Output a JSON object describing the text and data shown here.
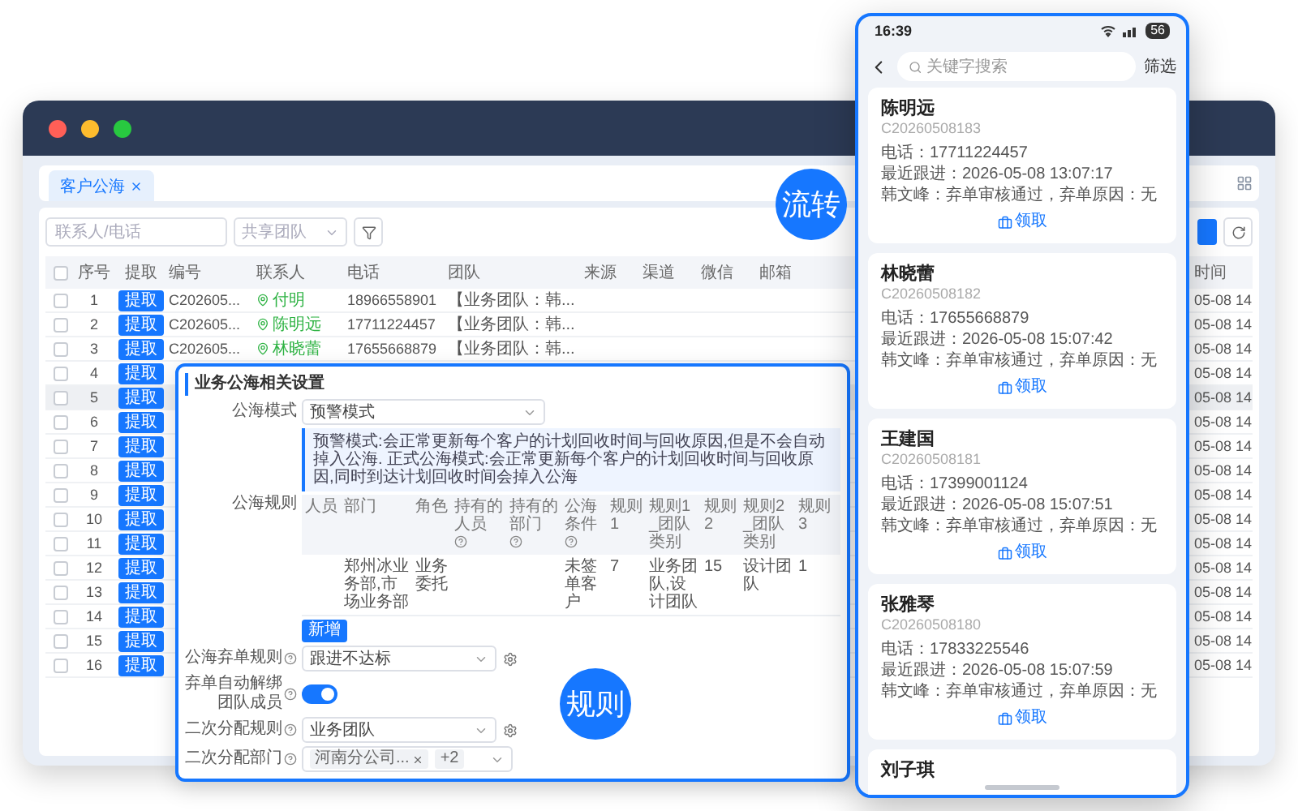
{
  "browser": {
    "tab": {
      "label": "客户公海",
      "closable": true
    },
    "toolbar": {
      "search_placeholder": "联系人/电话",
      "team_placeholder": "共享团队"
    },
    "table": {
      "header_checked": false,
      "columns": [
        "序号",
        "提取",
        "编号",
        "联系人",
        "电话",
        "团队",
        "来源",
        "渠道",
        "微信",
        "邮箱"
      ],
      "time_column": "时间",
      "rows": [
        {
          "index": "1",
          "action": "提取",
          "code": "C202605...",
          "contact": "付明",
          "phone": "18966558901",
          "team": "【业务团队：韩...",
          "time": "05-08 14",
          "checked": false,
          "hovered": false
        },
        {
          "index": "2",
          "action": "提取",
          "code": "C202605...",
          "contact": "陈明远",
          "phone": "17711224457",
          "team": "【业务团队：韩...",
          "time": "05-08 14",
          "checked": false,
          "hovered": false
        },
        {
          "index": "3",
          "action": "提取",
          "code": "C202605...",
          "contact": "林晓蕾",
          "phone": "17655668879",
          "team": "【业务团队：韩...",
          "time": "05-08 14",
          "checked": false,
          "hovered": false
        },
        {
          "index": "4",
          "action": "提取",
          "time": "05-08 14",
          "checked": false,
          "hovered": false
        },
        {
          "index": "5",
          "action": "提取",
          "time": "05-08 14",
          "checked": false,
          "hovered": true
        },
        {
          "index": "6",
          "action": "提取",
          "time": "05-08 14",
          "checked": false,
          "hovered": false
        },
        {
          "index": "7",
          "action": "提取",
          "time": "05-08 14",
          "checked": false,
          "hovered": false
        },
        {
          "index": "8",
          "action": "提取",
          "time": "05-08 14",
          "checked": false,
          "hovered": false
        },
        {
          "index": "9",
          "action": "提取",
          "time": "05-08 14",
          "checked": false,
          "hovered": false
        },
        {
          "index": "10",
          "action": "提取",
          "time": "05-08 14",
          "checked": false,
          "hovered": false
        },
        {
          "index": "11",
          "action": "提取",
          "time": "05-08 14",
          "checked": false,
          "hovered": false
        },
        {
          "index": "12",
          "action": "提取",
          "time": "05-08 14",
          "checked": false,
          "hovered": false
        },
        {
          "index": "13",
          "action": "提取",
          "time": "05-08 14",
          "checked": false,
          "hovered": false
        },
        {
          "index": "14",
          "action": "提取",
          "time": "05-08 14",
          "checked": false,
          "hovered": false
        },
        {
          "index": "15",
          "action": "提取",
          "time": "05-08 14",
          "checked": false,
          "hovered": false
        },
        {
          "index": "16",
          "action": "提取",
          "time": "05-08 14",
          "checked": false,
          "hovered": false
        }
      ]
    }
  },
  "dialog": {
    "title": "业务公海相关设置",
    "mode": {
      "label": "公海模式",
      "value": "预警模式"
    },
    "note": "预警模式:会正常更新每个客户的计划回收时间与回收原因,但是不会自动掉入公海. 正式公海模式:会正常更新每个客户的计划回收时间与回收原因,同时到达计划回收时间会掉入公海",
    "rules": {
      "label": "公海规则",
      "columns": [
        {
          "label": "人员",
          "help": false
        },
        {
          "label": "部门",
          "help": false
        },
        {
          "label": "角色",
          "help": false
        },
        {
          "label": "持有的人员",
          "help": true
        },
        {
          "label": "持有的部门",
          "help": true
        },
        {
          "label": "公海条件",
          "help": true
        },
        {
          "label": "规则1",
          "help": false
        },
        {
          "label": "规则1_团队类别",
          "help": false
        },
        {
          "label": "规则2",
          "help": false
        },
        {
          "label": "规则2_团队类别",
          "help": false
        },
        {
          "label": "规则3",
          "help": false
        }
      ],
      "rows": [
        [
          null,
          "郑州冰业务部,市场业务部",
          "业务委托",
          null,
          null,
          "未签单客户",
          "7",
          "业务团队,设计团队",
          "15",
          "设计团队",
          "1"
        ]
      ],
      "add_label": "新增"
    },
    "settings": [
      {
        "kind": "select",
        "label": "公海弃单规则",
        "help": true,
        "value": "跟进不达标",
        "gear": true
      },
      {
        "kind": "toggle",
        "label": "弃单自动解绑团队成员",
        "help": true,
        "on": true
      },
      {
        "kind": "select",
        "label": "二次分配规则",
        "help": true,
        "value": "业务团队",
        "gear": true
      },
      {
        "kind": "tags",
        "label": "二次分配部门",
        "help": true,
        "tags": [
          "河南分公司..."
        ],
        "more": "+2"
      }
    ]
  },
  "phone": {
    "status": {
      "time": "16:39",
      "battery": "56"
    },
    "search": {
      "placeholder": "关键字搜索"
    },
    "filter": "筛选",
    "cards": [
      {
        "name": "陈明远",
        "code": "C20260508183",
        "lines": [
          "电话：17711224457",
          "最近跟进：2026-05-08 13:07:17",
          "韩文峰：弃单审核通过，弃单原因：无"
        ],
        "action": "领取"
      },
      {
        "name": "林晓蕾",
        "code": "C20260508182",
        "lines": [
          "电话：17655668879",
          "最近跟进：2026-05-08 15:07:42",
          "韩文峰：弃单审核通过，弃单原因：无"
        ],
        "action": "领取"
      },
      {
        "name": "王建国",
        "code": "C20260508181",
        "lines": [
          "电话：17399001124",
          "最近跟进：2026-05-08 15:07:51",
          "韩文峰：弃单审核通过，弃单原因：无"
        ],
        "action": "领取"
      },
      {
        "name": "张雅琴",
        "code": "C20260508180",
        "lines": [
          "电话：17833225546",
          "最近跟进：2026-05-08 15:07:59",
          "韩文峰：弃单审核通过，弃单原因：无"
        ],
        "action": "领取"
      }
    ],
    "peek_name": "刘子琪"
  },
  "badges": [
    "流转",
    "规则"
  ]
}
